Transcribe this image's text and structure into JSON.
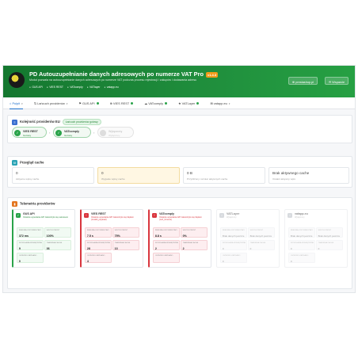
{
  "header": {
    "title": "PD Autouzupełnianie danych adresowych po numerze VAT Pro",
    "version": "v1.4.3",
    "subtitle": "Moduł pozwala na autouzupełnianie danych adresowych po numerze VAT podczas procesu rejestracji / zakupów i dodawania adresu",
    "badges": [
      "GUS API",
      "VIES REST",
      "VATcomply",
      "VATlayer",
      "vatapp.eu"
    ],
    "btn_settings": "prestashop.pl",
    "btn_support": "Wsparcie"
  },
  "tabs": [
    {
      "label": "Pulpit",
      "active": true,
      "dot": ""
    },
    {
      "label": "Lańcuch providerów",
      "active": false,
      "dot": ""
    },
    {
      "label": "GUS API",
      "active": false,
      "dot": "#2aa34a"
    },
    {
      "label": "VIES REST",
      "active": false,
      "dot": "#2aa34a"
    },
    {
      "label": "VATcomply",
      "active": false,
      "dot": "#2aa34a"
    },
    {
      "label": "VATLayer",
      "active": false,
      "dot": "#2aa34a"
    },
    {
      "label": "vatapp.eu",
      "active": false,
      "dot": ""
    }
  ],
  "chain": {
    "title": "Kolejność providerów EU",
    "pill": "Łańcuch providerów gotowy",
    "items": [
      {
        "name": "VIES REST",
        "status": "Gotowy",
        "active": true
      },
      {
        "name": "VATcomply",
        "status": "Gotowy",
        "active": true
      },
      {
        "name": "Wyłączony",
        "status": "Wyłączony",
        "active": false
      }
    ]
  },
  "cache": {
    "title": "Przegląd cache",
    "boxes": [
      {
        "value": "0",
        "label": "Aktywne wpisy cache",
        "warn": false
      },
      {
        "value": "0",
        "label": "Wygasłe wpisy cache",
        "warn": true
      },
      {
        "value": "0 B",
        "label": "Przybliżony rozmiar aktywnych cache",
        "warn": false
      },
      {
        "value": "Brak aktywnego cache",
        "label": "Ostatni aktywny wpis",
        "warn": false
      }
    ]
  },
  "telemetry": {
    "title": "Telemetria providerów",
    "providers": [
      {
        "name": "GUS API",
        "state": "ok",
        "desc": "Ostatnie wywołanie API zakończyło się sukcesem",
        "stats": [
          [
            "ŚREDNIA ODPOWIEDŹ API",
            "372 ms"
          ],
          [
            "SKUTECZNOŚĆ",
            "100%"
          ],
          [
            "WYWOŁANIA ZEWNĘTRZNE",
            "9"
          ],
          [
            "TRAFIENIA CACHE",
            "36"
          ],
          [
            "OSTATNIO ZAPISANO",
            "0"
          ]
        ]
      },
      {
        "name": "VIES REST",
        "state": "err",
        "desc": "Ostatnie wywołanie API zakończyło się błędem (invalid_payload)",
        "stats": [
          [
            "ŚREDNIA ODPOWIEDŹ API",
            "7.5 s"
          ],
          [
            "SKUTECZNOŚĆ",
            "75%"
          ],
          [
            "WYWOŁANIA ZEWNĘTRZNE",
            "28"
          ],
          [
            "TRAFIENIA CACHE",
            "13"
          ],
          [
            "OSTATNIO ZAPISANO",
            "4"
          ]
        ]
      },
      {
        "name": "VATcomply",
        "state": "err",
        "desc": "Ostatnie wywołanie API zakończyło się błędem (curl_timeout)",
        "stats": [
          [
            "ŚREDNIA ODPOWIEDŹ API",
            "8.8 s"
          ],
          [
            "SKUTECZNOŚĆ",
            "0%"
          ],
          [
            "WYWOŁANIA ZEWNĘTRZNE",
            "2"
          ],
          [
            "TRAFIENIA CACHE",
            "2"
          ],
          [
            "OSTATNIO ZAPISANO",
            ""
          ]
        ]
      },
      {
        "name": "VATLayer",
        "state": "off",
        "desc": "Wyłączony",
        "stats": [
          [
            "ŚREDNIA ODPOWIEDŹ API",
            "Brak danych jeszcze"
          ],
          [
            "SKUTECZNOŚĆ",
            "Brak danych jeszcze"
          ],
          [
            "WYWOŁANIA ZEWNĘTRZNE",
            "0"
          ],
          [
            "TRAFIENIA CACHE",
            "0"
          ],
          [
            "OSTATNIO ZAPISANO",
            "0"
          ]
        ]
      },
      {
        "name": "vatapp.eu",
        "state": "off",
        "desc": "Wyłączony",
        "stats": [
          [
            "ŚREDNIA ODPOWIEDŹ API",
            "Brak danych jeszcze"
          ],
          [
            "SKUTECZNOŚĆ",
            "Brak danych jeszcze"
          ],
          [
            "WYWOŁANIA ZEWNĘTRZNE",
            "0"
          ],
          [
            "TRAFIENIA CACHE",
            "0"
          ],
          [
            "OSTATNIO ZAPISANO",
            "0"
          ]
        ]
      }
    ]
  }
}
